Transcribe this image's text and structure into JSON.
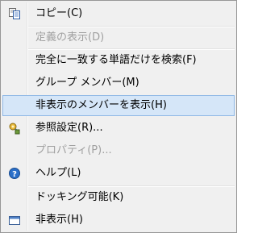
{
  "menu": {
    "items": [
      {
        "label": "コピー(C)",
        "icon": "copy-icon",
        "enabled": true
      },
      {
        "label": "定義の表示(D)",
        "icon": null,
        "enabled": false
      },
      {
        "label": "完全に一致する単語だけを検索(F)",
        "icon": null,
        "enabled": true
      },
      {
        "label": "グループ メンバー(M)",
        "icon": null,
        "enabled": true
      },
      {
        "label": "非表示のメンバーを表示(H)",
        "icon": null,
        "enabled": true,
        "highlighted": true
      },
      {
        "label": "参照設定(R)...",
        "icon": "reference-settings-icon",
        "enabled": true
      },
      {
        "label": "プロパティ(P)...",
        "icon": null,
        "enabled": false
      },
      {
        "label": "ヘルプ(L)",
        "icon": "help-icon",
        "enabled": true
      },
      {
        "label": "ドッキング可能(K)",
        "icon": null,
        "enabled": true
      },
      {
        "label": "非表示(H)",
        "icon": "window-icon",
        "enabled": true
      }
    ]
  },
  "colors": {
    "highlight_bg": "#d5e6f8",
    "highlight_border": "#8fb8e6",
    "disabled_text": "#a0a0a0",
    "help_icon_blue": "#2a6fc9"
  }
}
